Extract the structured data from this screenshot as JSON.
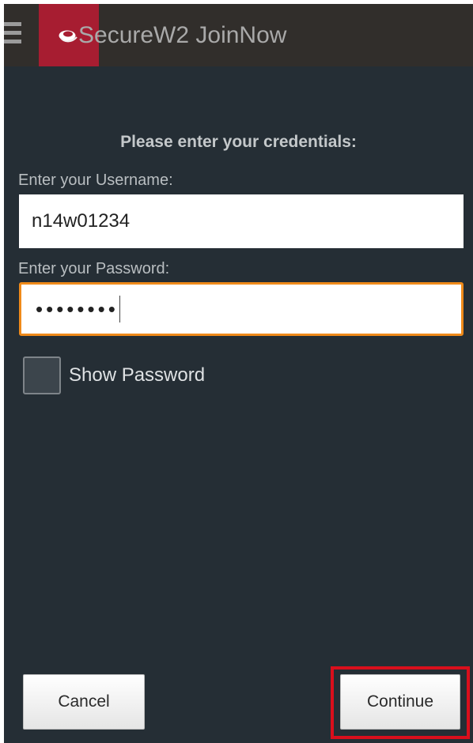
{
  "app": {
    "title": "SecureW2 JoinNow",
    "menu_icon": "hamburger-menu-icon",
    "logo_icon": "securew2-logo-icon",
    "brand_color": "#a71d31",
    "accent_color": "#ef8a1a"
  },
  "form": {
    "heading": "Please enter your credentials:",
    "username_label": "Enter your Username:",
    "username_value": "n14w01234",
    "password_label": "Enter your Password:",
    "password_value": "••••••••",
    "show_password_label": "Show Password",
    "show_password_checked": false
  },
  "buttons": {
    "cancel": "Cancel",
    "continue": "Continue",
    "highlight_color": "#d90f1c"
  }
}
